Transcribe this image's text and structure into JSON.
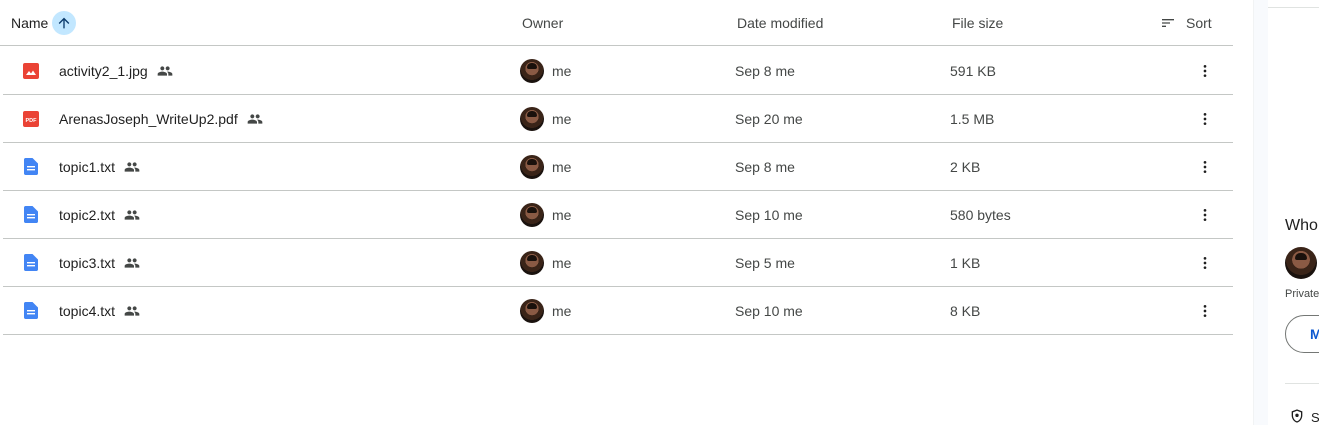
{
  "header": {
    "name": "Name",
    "owner": "Owner",
    "date_modified": "Date modified",
    "file_size": "File size",
    "sort": "Sort"
  },
  "files": [
    {
      "name": "activity2_1.jpg",
      "type": "image",
      "owner": "me",
      "date": "Sep 8 me",
      "size": "591 KB"
    },
    {
      "name": "ArenasJoseph_WriteUp2.pdf",
      "type": "pdf",
      "owner": "me",
      "date": "Sep 20 me",
      "size": "1.5 MB"
    },
    {
      "name": "topic1.txt",
      "type": "doc",
      "owner": "me",
      "date": "Sep 8 me",
      "size": "2 KB"
    },
    {
      "name": "topic2.txt",
      "type": "doc",
      "owner": "me",
      "date": "Sep 10 me",
      "size": "580 bytes"
    },
    {
      "name": "topic3.txt",
      "type": "doc",
      "owner": "me",
      "date": "Sep 5 me",
      "size": "1 KB"
    },
    {
      "name": "topic4.txt",
      "type": "doc",
      "owner": "me",
      "date": "Sep 10 me",
      "size": "8 KB"
    }
  ],
  "side_panel": {
    "who_title": "Who",
    "private_text": "Private",
    "manage_label": "M",
    "bottom_text": "S"
  },
  "colors": {
    "image_icon": "#ea4335",
    "pdf_icon": "#ea4335",
    "doc_icon": "#4285f4",
    "sort_active": "#c2e7ff",
    "accent": "#0b57d0"
  },
  "icons": {
    "sort_direction": "arrow-up-icon",
    "sort_menu": "sort-lines-icon",
    "shared": "people-icon",
    "more": "more-vert-icon"
  }
}
